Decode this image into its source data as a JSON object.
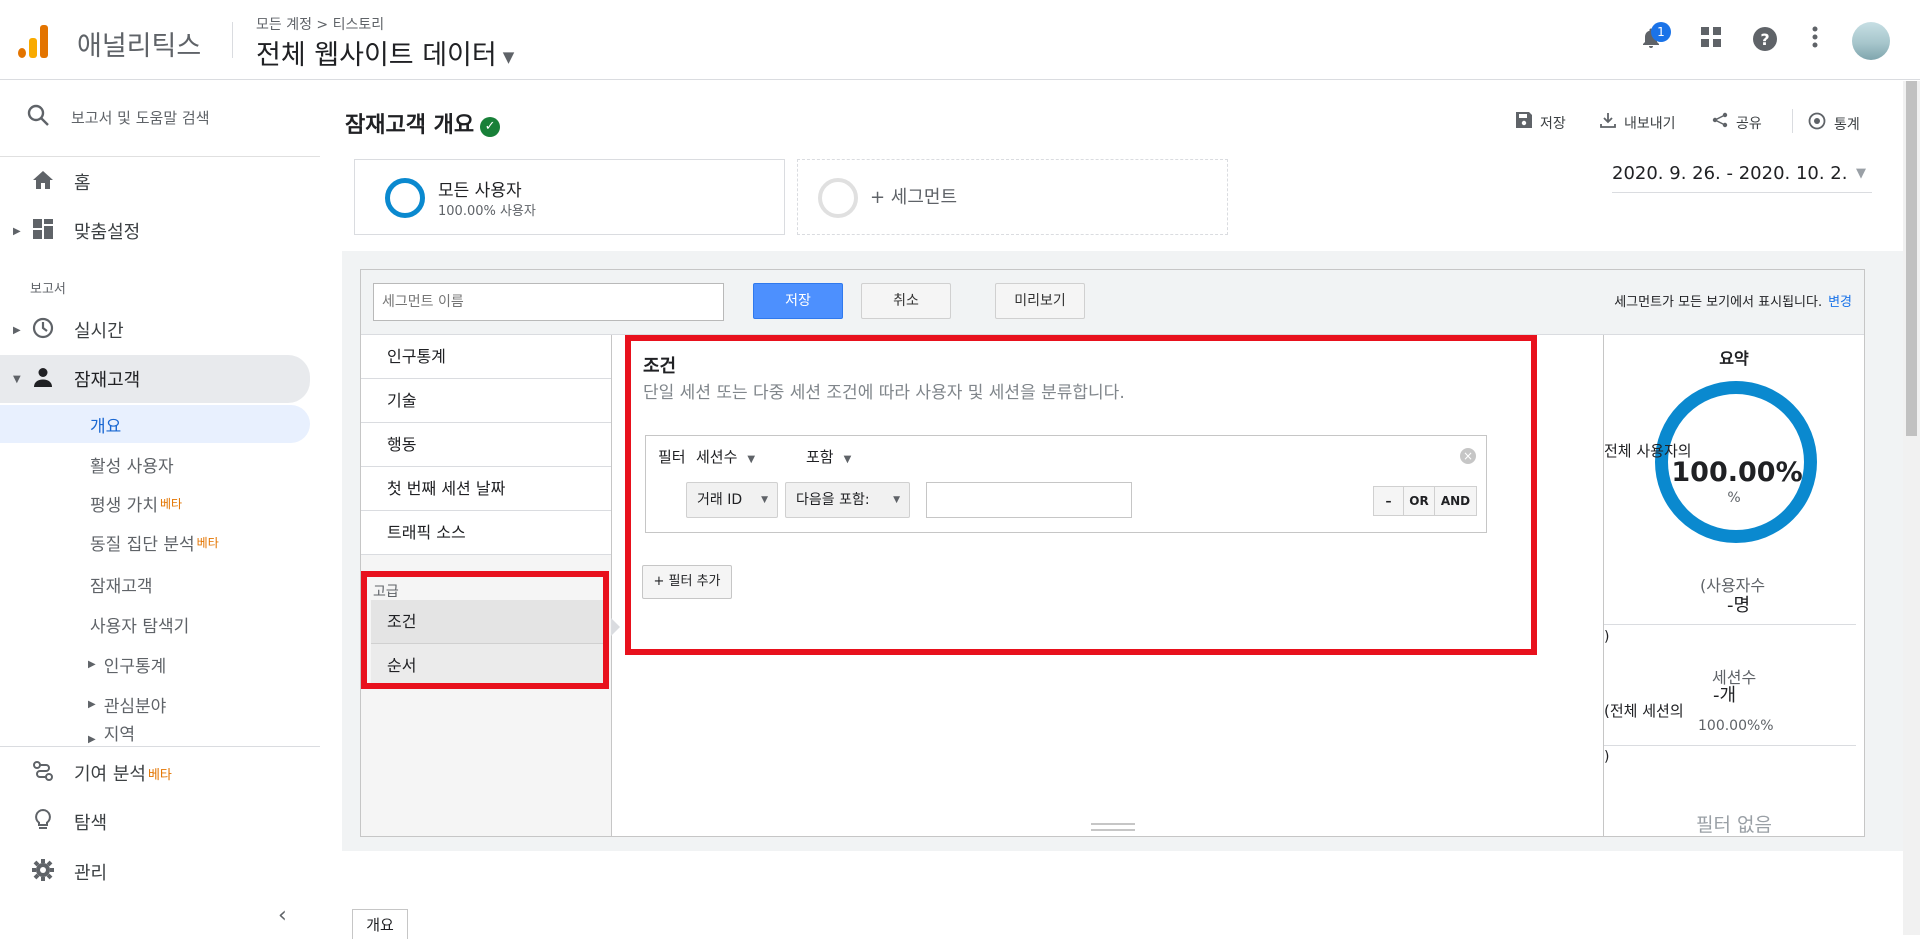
{
  "app": {
    "name": "애널리틱스",
    "breadcrumb": "모든 계정 > 티스토리",
    "view_name": "전체 웹사이트 데이터",
    "notification_count": "1",
    "icons": [
      "bell-icon",
      "apps-grid-icon",
      "help-icon",
      "more-vert-icon"
    ]
  },
  "sidebar": {
    "search_label": "보고서 및 도움말 검색",
    "home": "홈",
    "customization": "맞춤설정",
    "reports_section": "보고서",
    "realtime": "실시간",
    "audience": "잠재고객",
    "audience_items": [
      {
        "label": "개요",
        "active": true
      },
      {
        "label": "활성 사용자"
      },
      {
        "label": "평생 가치",
        "beta": "베타"
      },
      {
        "label": "동질 집단 분석",
        "beta": "베타"
      },
      {
        "label": "잠재고객"
      },
      {
        "label": "사용자 탐색기"
      },
      {
        "label": "인구통계"
      },
      {
        "label": "관심분야"
      },
      {
        "label": "지역"
      }
    ],
    "attribution": "기여 분석",
    "attribution_beta": "베타",
    "discover": "탐색",
    "admin": "관리"
  },
  "header": {
    "title": "잠재고객 개요",
    "actions": {
      "save": "저장",
      "export": "내보내기",
      "share": "공유",
      "insights": "통계"
    }
  },
  "segments": {
    "all_users_name": "모든 사용자",
    "all_users_pct": "100.00% 사용자",
    "add_segment": "+ 세그먼트"
  },
  "date_range": "2020. 9. 26. - 2020. 10. 2.",
  "editor": {
    "name_placeholder": "세그먼트 이름",
    "save": "저장",
    "cancel": "취소",
    "preview": "미리보기",
    "notice": "세그먼트가 모든 보기에서 표시됩니다.",
    "change_link": "변경",
    "tabs": [
      "인구통계",
      "기술",
      "행동",
      "첫 번째 세션 날짜",
      "트래픽 소스"
    ],
    "advanced_label": "고급",
    "advanced_items": [
      "조건",
      "순서"
    ],
    "condition": {
      "title": "조건",
      "description": "단일 세션 또는 다중 세션 조건에 따라 사용자 및 세션을 분류합니다.",
      "filter_label": "필터",
      "filter_scope": "세션수",
      "filter_mode": "포함",
      "dimension": "거래 ID",
      "operator": "다음을 포함:",
      "value": "",
      "logic": [
        "–",
        "OR",
        "AND"
      ],
      "add_filter": "+ 필터 추가"
    },
    "summary": {
      "title": "요약",
      "of_all_users": "전체 사용자의",
      "pct": "100.00%",
      "pct_unit": "%",
      "ring_fraction": 1.0,
      "users_label": "(사용자수",
      "users_value": "-명",
      "close_paren": ")",
      "sessions_label": "세션수",
      "sessions_value": "-개",
      "of_all_sessions": "(전체 세션의",
      "sessions_pct": "100.00%%",
      "no_filter": "필터 없음"
    }
  },
  "bottom_tab": "개요",
  "colors": {
    "accent_blue": "#0a89cf",
    "highlight_red": "#e8111d",
    "save_button": "#4d90fe",
    "beta_orange": "#e37400"
  }
}
